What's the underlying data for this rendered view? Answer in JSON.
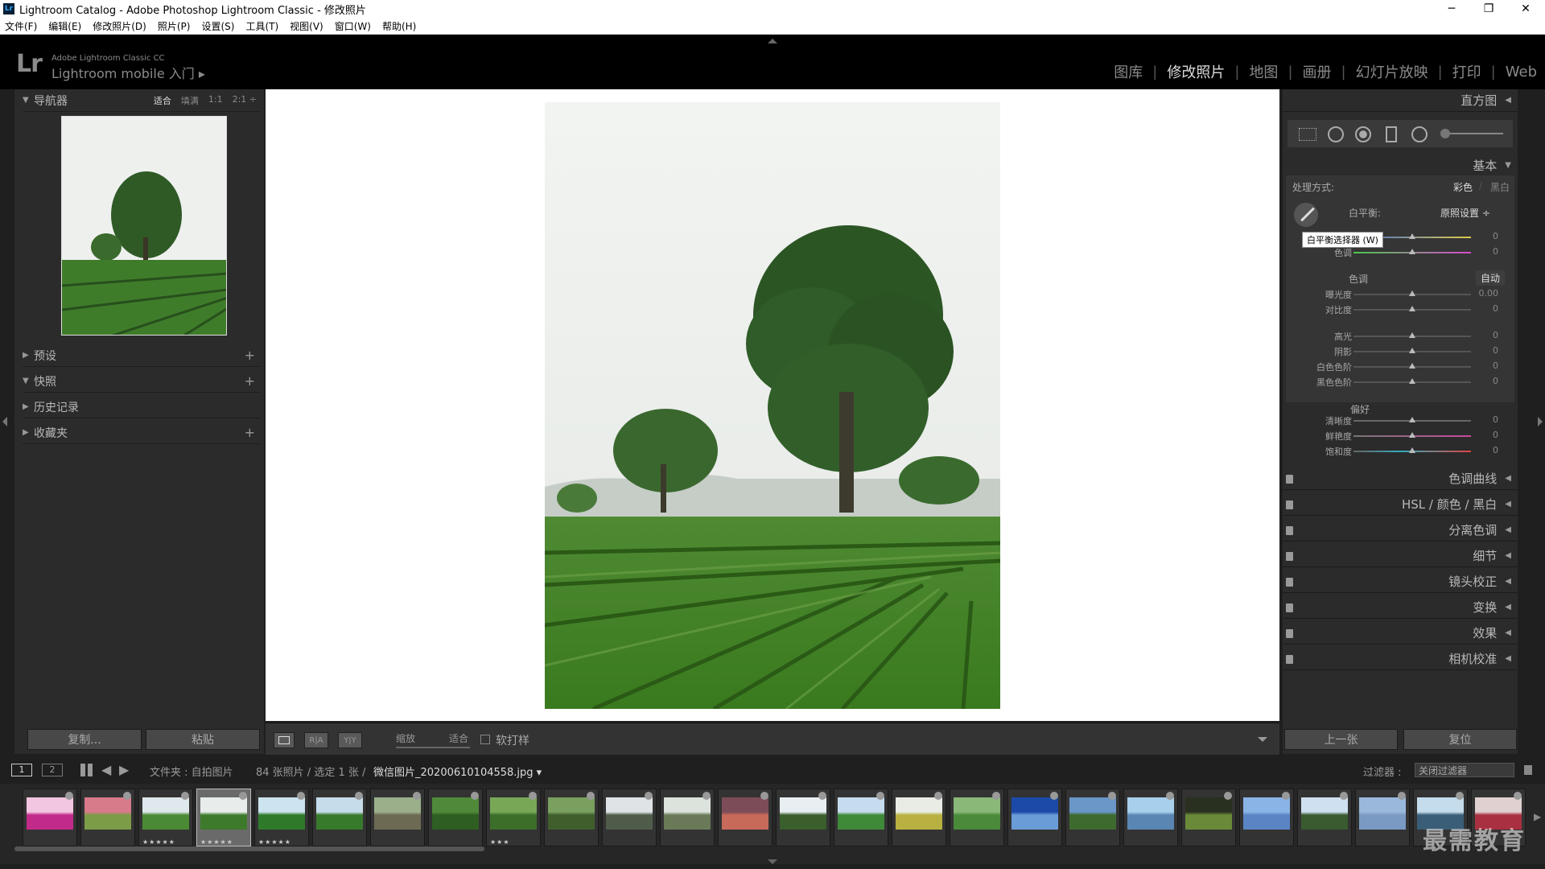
{
  "window": {
    "title": "Lightroom Catalog - Adobe Photoshop Lightroom Classic - 修改照片",
    "icon": "Lr",
    "controls": [
      "minimize-icon",
      "maximize-icon",
      "close-icon"
    ]
  },
  "menu": [
    "文件(F)",
    "编辑(E)",
    "修改照片(D)",
    "照片(P)",
    "设置(S)",
    "工具(T)",
    "视图(V)",
    "窗口(W)",
    "帮助(H)"
  ],
  "identity": {
    "logo": "Lr",
    "product": "Adobe Lightroom Classic CC",
    "mobile": "Lightroom mobile 入门 ▸"
  },
  "modules": [
    {
      "label": "图库"
    },
    {
      "label": "修改照片",
      "active": true
    },
    {
      "label": "地图"
    },
    {
      "label": "画册"
    },
    {
      "label": "幻灯片放映"
    },
    {
      "label": "打印"
    },
    {
      "label": "Web"
    }
  ],
  "left": {
    "navigator": {
      "title": "导航器",
      "options": [
        "适合",
        "填满",
        "1:1",
        "2:1 ÷"
      ],
      "active": "适合"
    },
    "sections": [
      {
        "label": "预设",
        "open": false,
        "plus": true
      },
      {
        "label": "快照",
        "open": true,
        "plus": true
      },
      {
        "label": "历史记录",
        "open": false,
        "plus": false
      },
      {
        "label": "收藏夹",
        "open": false,
        "plus": true
      }
    ],
    "copy_label": "复制...",
    "paste_label": "粘贴"
  },
  "toolbar": {
    "zoom_label": "缩放",
    "fit_label": "适合",
    "softproof_label": "软打样",
    "view_ra": "R|A",
    "view_yy": "Y|Y"
  },
  "right": {
    "histogram_title": "直方图",
    "basic_title": "基本",
    "treatment_label": "处理方式:",
    "treatment_color": "彩色",
    "treatment_bw": "黑白",
    "wb_label": "白平衡:",
    "wb_value": "原照设置 ÷",
    "wb_tooltip": "白平衡选择器 (W)",
    "wb_sliders": [
      {
        "label": "色温",
        "value": "0",
        "pos": 0.5,
        "grad": "temp"
      },
      {
        "label": "色调",
        "value": "0",
        "pos": 0.5,
        "grad": "tint"
      }
    ],
    "tone_title": "色调",
    "auto_label": "自动",
    "tone_sliders": [
      {
        "label": "曝光度",
        "value": "0.00",
        "pos": 0.5
      },
      {
        "label": "对比度",
        "value": "0",
        "pos": 0.5
      }
    ],
    "tone2_sliders": [
      {
        "label": "高光",
        "value": "0",
        "pos": 0.5
      },
      {
        "label": "阴影",
        "value": "0",
        "pos": 0.5
      },
      {
        "label": "白色色阶",
        "value": "0",
        "pos": 0.5
      },
      {
        "label": "黑色色阶",
        "value": "0",
        "pos": 0.5
      }
    ],
    "presence_title": "偏好",
    "presence_sliders": [
      {
        "label": "清晰度",
        "value": "0",
        "pos": 0.5,
        "grad": "gray"
      },
      {
        "label": "鲜艳度",
        "value": "0",
        "pos": 0.5,
        "grad": "vib"
      },
      {
        "label": "饱和度",
        "value": "0",
        "pos": 0.5,
        "grad": "sat"
      }
    ],
    "panels": [
      "色调曲线",
      "HSL / 颜色 / 黑白",
      "分离色调",
      "细节",
      "镜头校正",
      "变换",
      "效果",
      "相机校准"
    ],
    "prev_label": "上一张",
    "reset_label": "复位"
  },
  "filmbar": {
    "page1": "1",
    "page2": "2",
    "source": "文件夹 : 自拍图片",
    "count": "84 张照片 / 选定 1 张 /",
    "filename": "微信图片_20200610104558.jpg ▾",
    "filter_label": "过滤器 :",
    "filter_value": "关闭过滤器"
  },
  "filmstrip": [
    {
      "c1": "#f2c6e0",
      "c2": "#c22a8a",
      "stars": ""
    },
    {
      "c1": "#d77a8a",
      "c2": "#7c9c48",
      "stars": ""
    },
    {
      "c1": "#dfe8ec",
      "c2": "#4b8a35",
      "stars": "★★★★★"
    },
    {
      "c1": "#e8ecea",
      "c2": "#3e7a2c",
      "stars": "★★★★★",
      "selected": true
    },
    {
      "c1": "#cde3f0",
      "c2": "#2e7a2a",
      "stars": "★★★★★"
    },
    {
      "c1": "#c7dceb",
      "c2": "#387a2b",
      "stars": ""
    },
    {
      "c1": "#9bb08a",
      "c2": "#6d6a54",
      "stars": ""
    },
    {
      "c1": "#4f8a3a",
      "c2": "#2f5e22",
      "stars": ""
    },
    {
      "c1": "#78a856",
      "c2": "#3c6e2a",
      "stars": "★★★"
    },
    {
      "c1": "#7aa060",
      "c2": "#405e2c",
      "stars": ""
    },
    {
      "c1": "#dfe3e6",
      "c2": "#4f5c4a",
      "stars": ""
    },
    {
      "c1": "#dce2dc",
      "c2": "#6a7a58",
      "stars": ""
    },
    {
      "c1": "#7c4c58",
      "c2": "#c86a5a",
      "stars": ""
    },
    {
      "c1": "#e8eef2",
      "c2": "#3a5e2c",
      "stars": ""
    },
    {
      "c1": "#c6dcee",
      "c2": "#3f8a38",
      "stars": ""
    },
    {
      "c1": "#e8ece4",
      "c2": "#b8b040",
      "stars": ""
    },
    {
      "c1": "#8ab878",
      "c2": "#4a8a3a",
      "stars": ""
    },
    {
      "c1": "#1c4aa8",
      "c2": "#6a9cd8",
      "stars": ""
    },
    {
      "c1": "#6a96c8",
      "c2": "#3e6a2e",
      "stars": ""
    },
    {
      "c1": "#a8d0ec",
      "c2": "#5a86b4",
      "stars": ""
    },
    {
      "c1": "#2a3020",
      "c2": "#6a8a3a",
      "stars": ""
    },
    {
      "c1": "#8ab4e6",
      "c2": "#5a84c4",
      "stars": ""
    },
    {
      "c1": "#cfe0f0",
      "c2": "#3a5a30",
      "stars": ""
    },
    {
      "c1": "#9ab8dc",
      "c2": "#7a9ac4",
      "stars": ""
    },
    {
      "c1": "#c4dcec",
      "c2": "#3a5e78",
      "stars": ""
    },
    {
      "c1": "#e0d0d0",
      "c2": "#a83040",
      "stars": ""
    }
  ],
  "watermark": "最需教育"
}
